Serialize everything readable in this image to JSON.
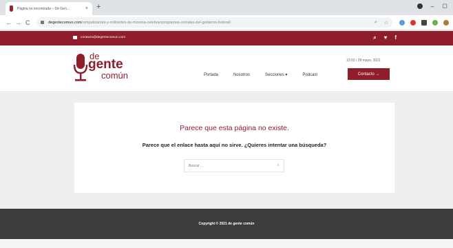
{
  "browser": {
    "tab_title": "Página no encontrada – De Gen…",
    "tab_close": "×",
    "new_tab": "+",
    "back": "←",
    "forward": "→",
    "reload": "C",
    "url_host": "degentecomun.com",
    "url_path": "/simpatizantes-y-militantes-de-morena-celebranprogramas-sociales-del-gobierno-federal/",
    "omnibox_icons": [
      "search-icon",
      "star-icon"
    ],
    "window_controls": [
      "minimize",
      "maximize"
    ]
  },
  "topbar": {
    "email": "contacto@degentecomun.com",
    "icons": [
      "search-icon",
      "twitter-icon",
      "facebook-icon"
    ]
  },
  "logo": {
    "de": "de",
    "gente": "gente",
    "comun": "común"
  },
  "nav": {
    "items": [
      {
        "label": "Portada"
      },
      {
        "label": "Nosotros"
      },
      {
        "label": "Secciones ▾"
      },
      {
        "label": "Podcast"
      }
    ],
    "date": "13:02 / 28 mayo, 2021",
    "contact_label": "Contacto →"
  },
  "main": {
    "title": "Parece que esta página no existe.",
    "message": "Parece que el enlace hasta aquí no sirve. ¿Quieres intentar una búsqueda?",
    "search_placeholder": "Buscar ...",
    "search_icon": "search-icon"
  },
  "footer": {
    "copyright": "Copyright © 2021 de gente común"
  },
  "colors": {
    "brand": "#8f1d2c",
    "footer": "#3c3c3c",
    "background": "#efefef"
  }
}
